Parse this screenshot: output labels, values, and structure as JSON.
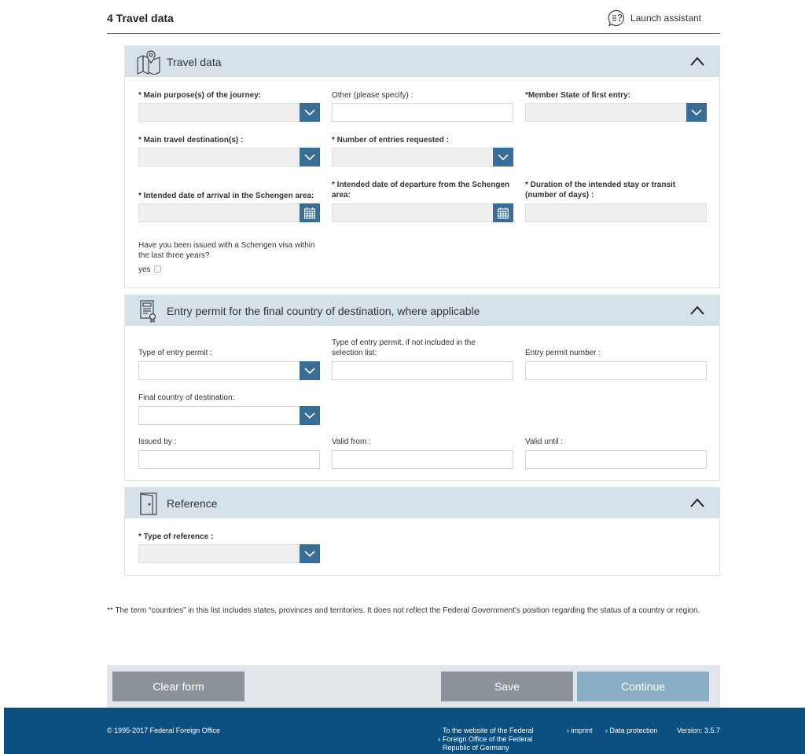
{
  "header": {
    "title": "4 Travel data",
    "assistant_label": "Launch assistant"
  },
  "sections": {
    "travel": {
      "title": "Travel data",
      "fields": {
        "purpose_label": "* Main purpose(s) of the journey:",
        "purpose_value": "",
        "other_label": "Other (please specify) :",
        "other_value": "",
        "member_state_label": "*Member State of first entry:",
        "member_state_value": "",
        "destination_label": "* Main travel destination(s) :",
        "destination_value": "",
        "entries_label": "* Number of entries requested :",
        "entries_value": "",
        "arrival_label": "* Intended date of arrival in the Schengen area:",
        "arrival_value": "",
        "departure_label": "* Intended date of departure from the Schengen area:",
        "departure_value": "",
        "duration_label": "* Duration of the intended stay or transit (number of days) :",
        "duration_value": "",
        "visa_question": "Have you been issued with a Schengen visa within the last three years?",
        "visa_yes_label": "yes",
        "visa_yes_checked": false
      }
    },
    "entry_permit": {
      "title": "Entry permit for the final country of destination, where applicable",
      "fields": {
        "type_label": "Type of entry permit :",
        "type_value": "",
        "type_other_label": "Type of entry permit, if not included in the selection list:",
        "type_other_value": "",
        "number_label": "Entry permit number :",
        "number_value": "",
        "final_country_label": "Final country of destination:",
        "final_country_value": "",
        "issued_by_label": "Issued by :",
        "issued_by_value": "",
        "valid_from_label": "Valid from :",
        "valid_from_value": "",
        "valid_until_label": "Valid until :",
        "valid_until_value": ""
      }
    },
    "reference": {
      "title": "Reference",
      "fields": {
        "type_label": "* Type of reference :",
        "type_value": ""
      }
    }
  },
  "footnote": "** The term “countries” in this list includes states, provinces and territories. It does not reflect the Federal Government's position regarding the status of a country or region.",
  "actions": {
    "clear_label": "Clear form",
    "save_label": "Save",
    "continue_label": "Continue"
  },
  "footer": {
    "copyright": "© 1995-2017 Federal Foreign Office",
    "fed_link": "To the website of the Federal Foreign Office of the Federal Republic of Germany",
    "imprint": "imprint",
    "data_protection": "Data protection",
    "version": "Version: 3.5.7",
    "arrow": "›"
  },
  "colors": {
    "accent": "#3a6d95",
    "section_header": "#d6e1e9",
    "footer_bg": "#0b5080",
    "button_grey": "#8d9499",
    "button_continue": "#8aaec4"
  }
}
